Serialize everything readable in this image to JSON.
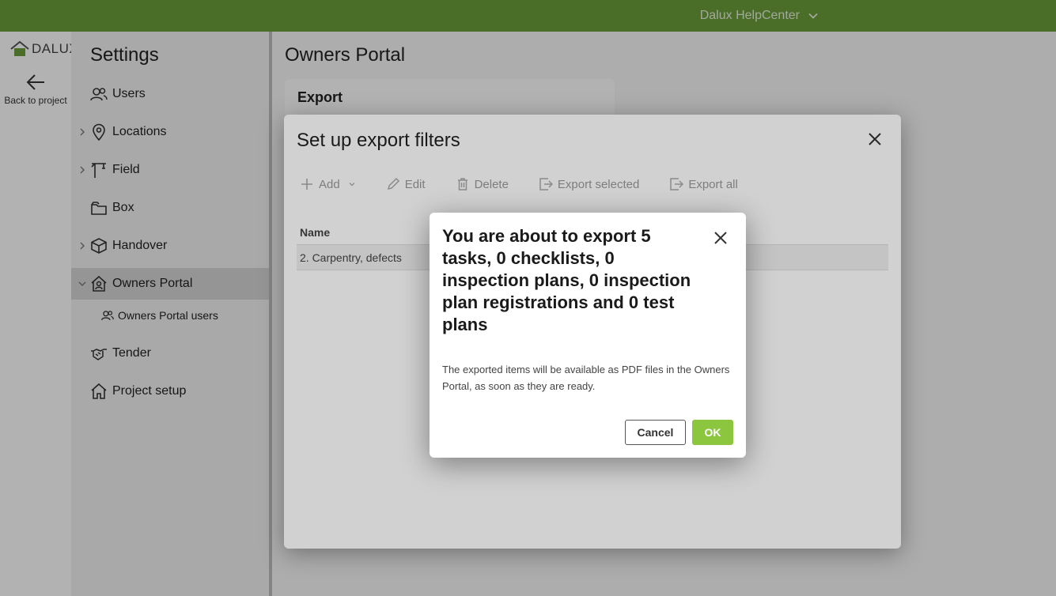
{
  "header": {
    "help_label": "Dalux HelpCenter",
    "help_icon": "chevron-down-icon"
  },
  "rail": {
    "logo_text": "DALUX",
    "back_label": "Back to project"
  },
  "settings": {
    "title": "Settings",
    "items": [
      {
        "label": "Users",
        "icon": "users-icon",
        "expandable": false
      },
      {
        "label": "Locations",
        "icon": "location-pin-icon",
        "expandable": true
      },
      {
        "label": "Field",
        "icon": "crane-icon",
        "expandable": true
      },
      {
        "label": "Box",
        "icon": "folder-icon",
        "expandable": false
      },
      {
        "label": "Handover",
        "icon": "cube-icon",
        "expandable": true
      },
      {
        "label": "Owners Portal",
        "icon": "house-user-icon",
        "expandable": true,
        "active": true
      },
      {
        "label": "Owners Portal users",
        "icon": "users-icon",
        "sub": true
      },
      {
        "label": "Tender",
        "icon": "handshake-icon",
        "expandable": false
      },
      {
        "label": "Project setup",
        "icon": "home-icon",
        "expandable": false
      }
    ]
  },
  "main": {
    "title": "Owners Portal",
    "card_title": "Export"
  },
  "filter_modal": {
    "title": "Set up export filters",
    "toolbar": [
      {
        "label": "Add",
        "icon": "plus-icon"
      },
      {
        "label": "Edit",
        "icon": "pencil-icon"
      },
      {
        "label": "Delete",
        "icon": "trash-icon"
      },
      {
        "label": "Export selected",
        "icon": "export-icon"
      },
      {
        "label": "Export all",
        "icon": "export-icon"
      }
    ],
    "column_name": "Name",
    "rows": [
      {
        "name": "2. Carpentry, defects"
      }
    ]
  },
  "confirm_dialog": {
    "title": "You are about to export 5 tasks, 0 checklists, 0 inspection plans, 0 inspection plan registrations and 0 test plans",
    "body": "The exported items will be available as PDF files in the Owners Portal, as soon as they are ready.",
    "cancel_label": "Cancel",
    "ok_label": "OK"
  },
  "colors": {
    "topbar": "#6a9c3a",
    "ok_button": "#8cc63f",
    "active_nav": "#d6d6d6"
  }
}
